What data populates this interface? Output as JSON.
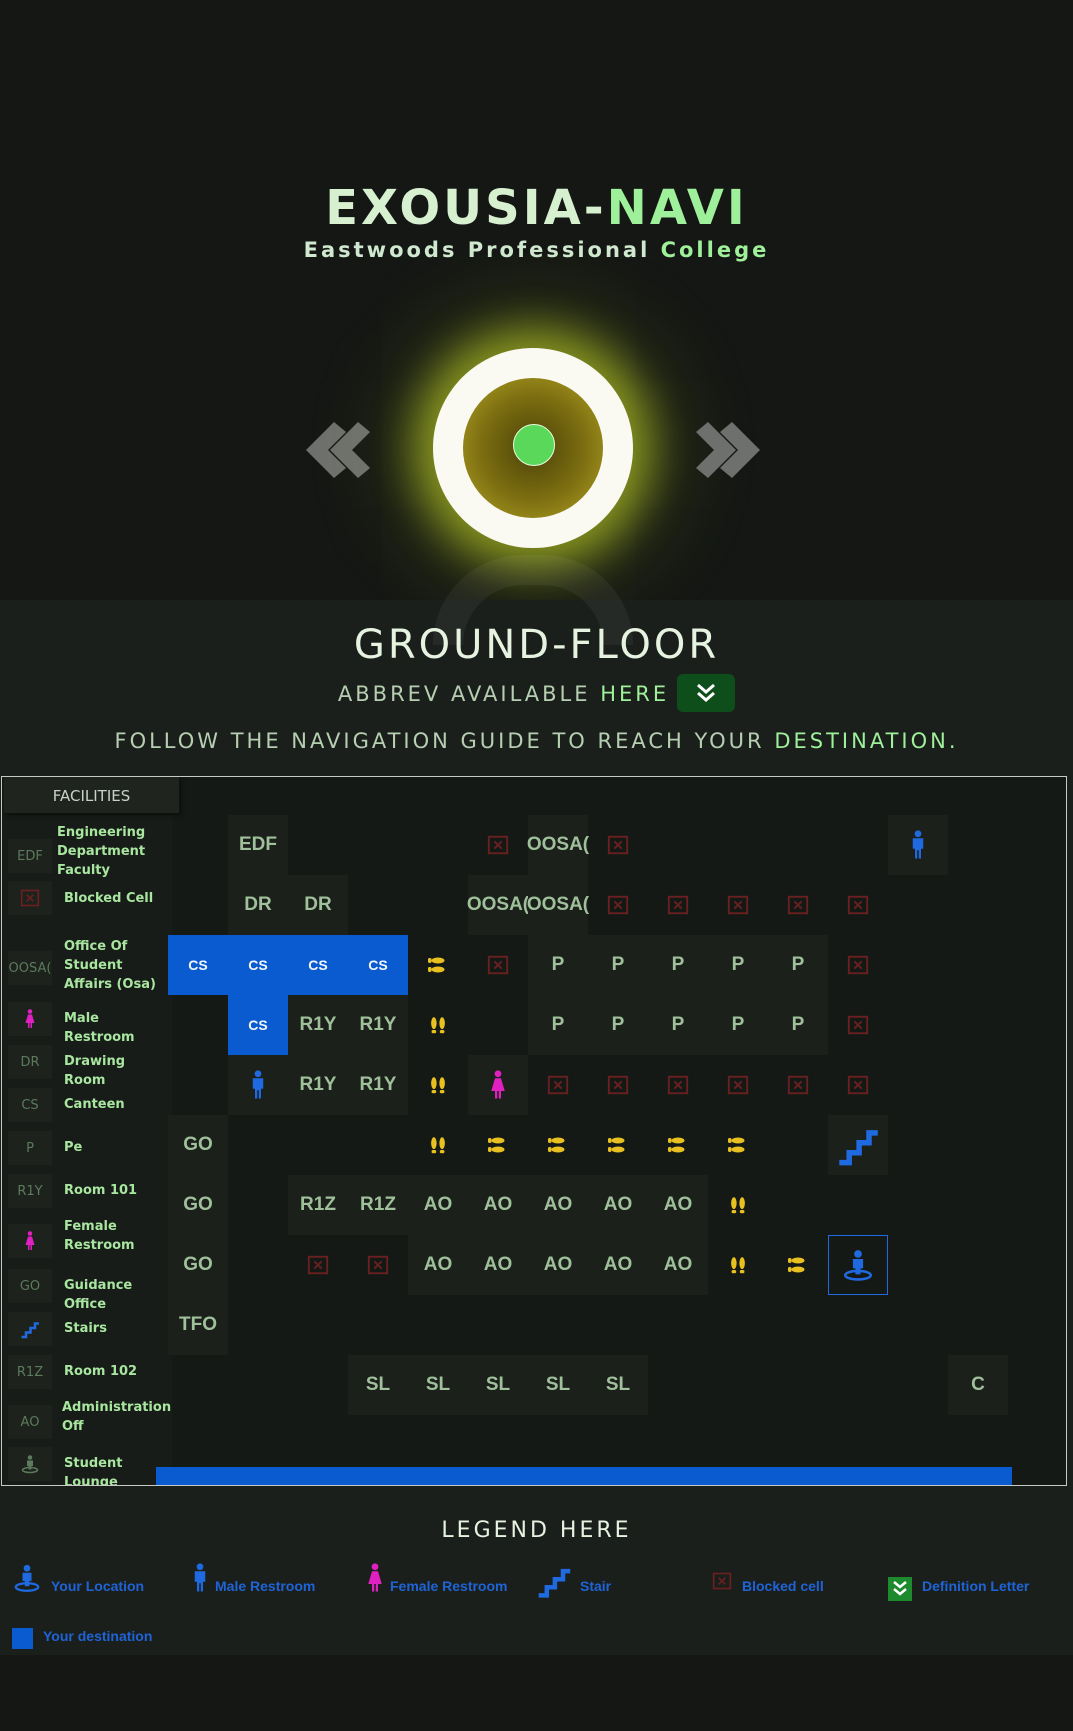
{
  "brand": {
    "title_main": "EXOUSIA-",
    "title_accent": "NAVI",
    "subtitle_main": "Eastwoods Professional ",
    "subtitle_accent": "College"
  },
  "floor": {
    "title": "GROUND-FLOOR",
    "abbrev_main": "ABBREV AVAILABLE ",
    "abbrev_accent": "HERE",
    "guide_main": "FOLLOW THE NAVIGATION GUIDE TO REACH YOUR ",
    "guide_accent": "DESTINATION."
  },
  "facilities": {
    "heading": "FACILITIES",
    "items": [
      {
        "abbr": "EDF",
        "name": "Engineering Department Faculty"
      },
      {
        "abbr": "",
        "icon": "blocked-icon",
        "name": "Blocked Cell"
      },
      {
        "abbr": "OOSA(",
        "name": "Office Of Student Affairs (Osa)"
      },
      {
        "abbr": "",
        "icon": "female-icon",
        "name": "Male Restroom"
      },
      {
        "abbr": "DR",
        "name": "Drawing Room"
      },
      {
        "abbr": "CS",
        "name": "Canteen"
      },
      {
        "abbr": "P",
        "name": "Pe"
      },
      {
        "abbr": "R1Y",
        "name": "Room 101"
      },
      {
        "abbr": "",
        "icon": "female-icon",
        "name": "Female Restroom"
      },
      {
        "abbr": "GO",
        "name": "Guidance Office"
      },
      {
        "abbr": "",
        "icon": "stairs-icon",
        "name": "Stairs"
      },
      {
        "abbr": "R1Z",
        "name": "Room 102"
      },
      {
        "abbr": "AO",
        "name": "Administration Off"
      },
      {
        "abbr": "",
        "icon": "student-lounge-icon",
        "name": "Student Lounge"
      }
    ]
  },
  "map": {
    "cells": [
      {
        "col": 1,
        "row": 0,
        "label": "EDF"
      },
      {
        "col": 5,
        "row": 0,
        "icon": "blocked"
      },
      {
        "col": 6,
        "row": 0,
        "label": "OOSA("
      },
      {
        "col": 7,
        "row": 0,
        "icon": "blocked"
      },
      {
        "col": 12,
        "row": 0,
        "icon": "male"
      },
      {
        "col": 1,
        "row": 1,
        "label": "DR"
      },
      {
        "col": 2,
        "row": 1,
        "label": "DR"
      },
      {
        "col": 5,
        "row": 1,
        "label": "OOSA("
      },
      {
        "col": 6,
        "row": 1,
        "label": "OOSA("
      },
      {
        "col": 7,
        "row": 1,
        "icon": "blocked"
      },
      {
        "col": 8,
        "row": 1,
        "icon": "blocked"
      },
      {
        "col": 9,
        "row": 1,
        "icon": "blocked"
      },
      {
        "col": 10,
        "row": 1,
        "icon": "blocked"
      },
      {
        "col": 11,
        "row": 1,
        "icon": "blocked"
      },
      {
        "col": 0,
        "row": 2,
        "label": "CS",
        "dest": true
      },
      {
        "col": 1,
        "row": 2,
        "label": "CS",
        "dest": true
      },
      {
        "col": 2,
        "row": 2,
        "label": "CS",
        "dest": true
      },
      {
        "col": 3,
        "row": 2,
        "label": "CS",
        "dest": true
      },
      {
        "col": 4,
        "row": 2,
        "icon": "foot-side"
      },
      {
        "col": 5,
        "row": 2,
        "icon": "blocked"
      },
      {
        "col": 6,
        "row": 2,
        "label": "P"
      },
      {
        "col": 7,
        "row": 2,
        "label": "P"
      },
      {
        "col": 8,
        "row": 2,
        "label": "P"
      },
      {
        "col": 9,
        "row": 2,
        "label": "P"
      },
      {
        "col": 10,
        "row": 2,
        "label": "P"
      },
      {
        "col": 11,
        "row": 2,
        "icon": "blocked"
      },
      {
        "col": 1,
        "row": 3,
        "label": "CS",
        "dest": true
      },
      {
        "col": 2,
        "row": 3,
        "label": "R1Y"
      },
      {
        "col": 3,
        "row": 3,
        "label": "R1Y"
      },
      {
        "col": 4,
        "row": 3,
        "icon": "foot-up"
      },
      {
        "col": 6,
        "row": 3,
        "label": "P"
      },
      {
        "col": 7,
        "row": 3,
        "label": "P"
      },
      {
        "col": 8,
        "row": 3,
        "label": "P"
      },
      {
        "col": 9,
        "row": 3,
        "label": "P"
      },
      {
        "col": 10,
        "row": 3,
        "label": "P"
      },
      {
        "col": 11,
        "row": 3,
        "icon": "blocked"
      },
      {
        "col": 1,
        "row": 4,
        "icon": "male"
      },
      {
        "col": 2,
        "row": 4,
        "label": "R1Y"
      },
      {
        "col": 3,
        "row": 4,
        "label": "R1Y"
      },
      {
        "col": 4,
        "row": 4,
        "icon": "foot-up"
      },
      {
        "col": 5,
        "row": 4,
        "icon": "female"
      },
      {
        "col": 6,
        "row": 4,
        "icon": "blocked"
      },
      {
        "col": 7,
        "row": 4,
        "icon": "blocked"
      },
      {
        "col": 8,
        "row": 4,
        "icon": "blocked"
      },
      {
        "col": 9,
        "row": 4,
        "icon": "blocked"
      },
      {
        "col": 10,
        "row": 4,
        "icon": "blocked"
      },
      {
        "col": 11,
        "row": 4,
        "icon": "blocked"
      },
      {
        "col": 0,
        "row": 5,
        "label": "GO"
      },
      {
        "col": 4,
        "row": 5,
        "icon": "foot-up"
      },
      {
        "col": 5,
        "row": 5,
        "icon": "foot-side"
      },
      {
        "col": 6,
        "row": 5,
        "icon": "foot-side"
      },
      {
        "col": 7,
        "row": 5,
        "icon": "foot-side"
      },
      {
        "col": 8,
        "row": 5,
        "icon": "foot-side"
      },
      {
        "col": 9,
        "row": 5,
        "icon": "foot-side"
      },
      {
        "col": 11,
        "row": 5,
        "icon": "stairs"
      },
      {
        "col": 0,
        "row": 6,
        "label": "GO"
      },
      {
        "col": 2,
        "row": 6,
        "label": "R1Z"
      },
      {
        "col": 3,
        "row": 6,
        "label": "R1Z"
      },
      {
        "col": 4,
        "row": 6,
        "label": "AO"
      },
      {
        "col": 5,
        "row": 6,
        "label": "AO"
      },
      {
        "col": 6,
        "row": 6,
        "label": "AO"
      },
      {
        "col": 7,
        "row": 6,
        "label": "AO"
      },
      {
        "col": 8,
        "row": 6,
        "label": "AO"
      },
      {
        "col": 9,
        "row": 6,
        "icon": "foot-up"
      },
      {
        "col": 0,
        "row": 7,
        "label": "GO"
      },
      {
        "col": 2,
        "row": 7,
        "icon": "blocked"
      },
      {
        "col": 3,
        "row": 7,
        "icon": "blocked"
      },
      {
        "col": 4,
        "row": 7,
        "label": "AO"
      },
      {
        "col": 5,
        "row": 7,
        "label": "AO"
      },
      {
        "col": 6,
        "row": 7,
        "label": "AO"
      },
      {
        "col": 7,
        "row": 7,
        "label": "AO"
      },
      {
        "col": 8,
        "row": 7,
        "label": "AO"
      },
      {
        "col": 9,
        "row": 7,
        "icon": "foot-up"
      },
      {
        "col": 10,
        "row": 7,
        "icon": "foot-side"
      },
      {
        "col": 11,
        "row": 7,
        "icon": "location",
        "you": true
      },
      {
        "col": 0,
        "row": 8,
        "label": "TFO"
      },
      {
        "col": 3,
        "row": 9,
        "label": "SL"
      },
      {
        "col": 4,
        "row": 9,
        "label": "SL"
      },
      {
        "col": 5,
        "row": 9,
        "label": "SL"
      },
      {
        "col": 6,
        "row": 9,
        "label": "SL"
      },
      {
        "col": 7,
        "row": 9,
        "label": "SL"
      },
      {
        "col": 13,
        "row": 9,
        "label": "C"
      }
    ]
  },
  "legend": {
    "title": "LEGEND HERE",
    "items": [
      {
        "icon": "location-icon",
        "label": "Your Location"
      },
      {
        "icon": "male-icon",
        "label": "Male Restroom"
      },
      {
        "icon": "female-icon",
        "label": "Female Restroom"
      },
      {
        "icon": "stairs-icon",
        "label": "Stair"
      },
      {
        "icon": "blocked-icon",
        "label": "Blocked cell"
      },
      {
        "icon": "chevron-down-icon",
        "label": "Definition Letter"
      },
      {
        "icon": "destination-swatch",
        "label": "Your destination"
      }
    ]
  },
  "colors": {
    "accent_green": "#9ff09a",
    "destination_blue": "#0b5bd0",
    "path_yellow": "#e8c020",
    "female_pink": "#e020c0",
    "blocked_red": "#6a2020"
  }
}
